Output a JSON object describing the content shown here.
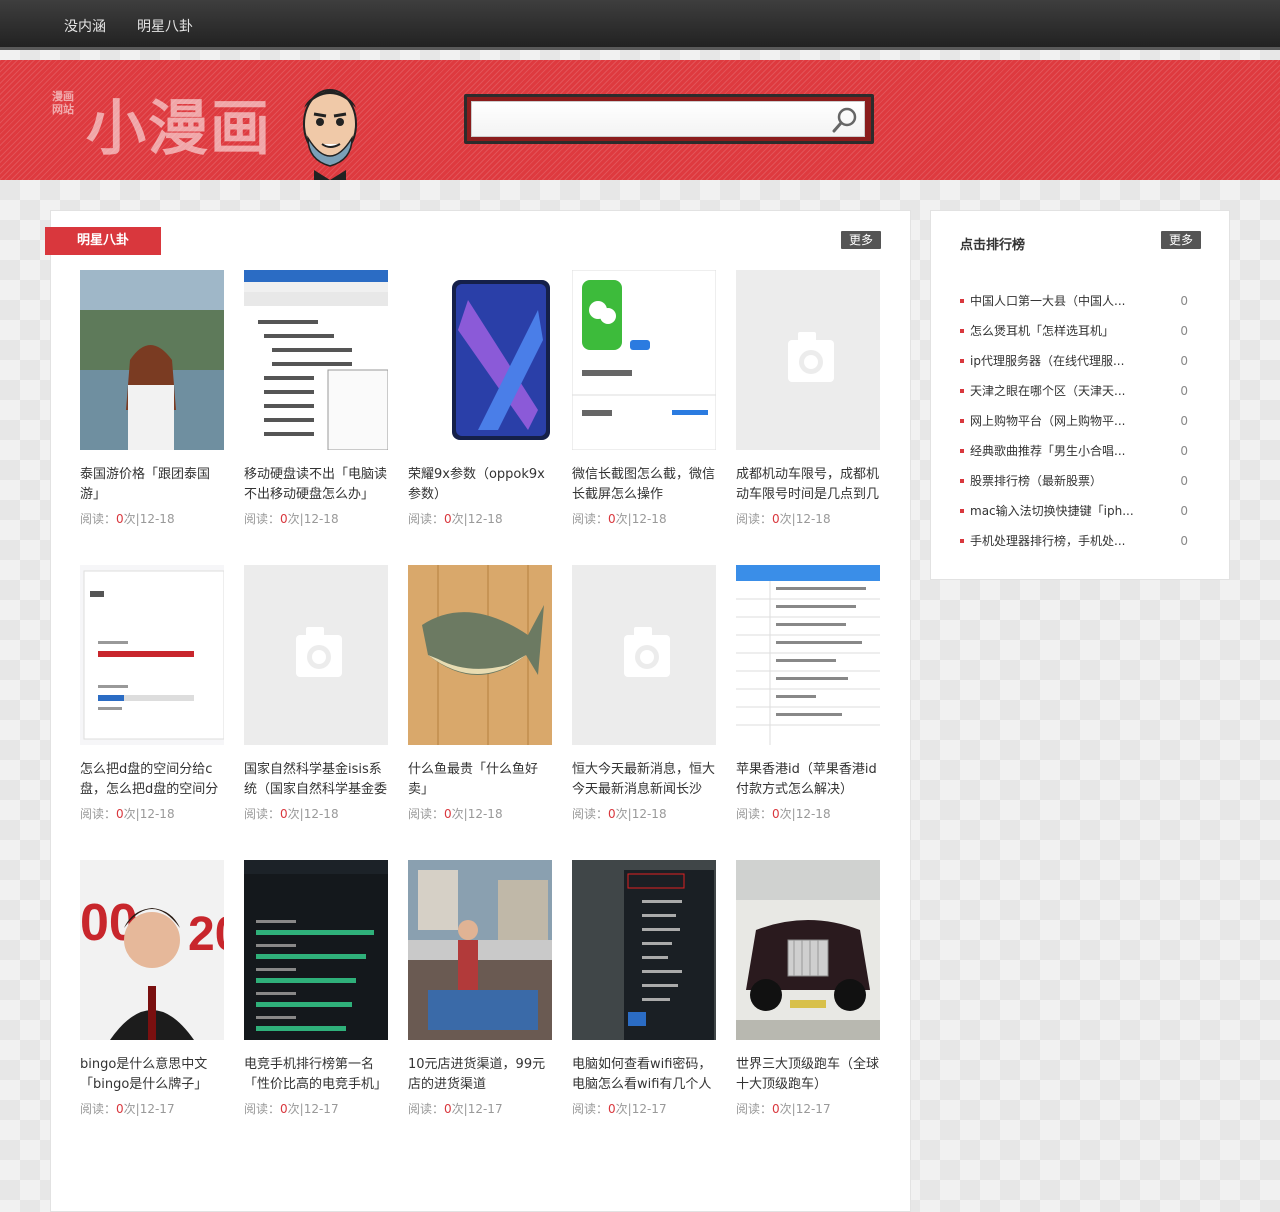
{
  "nav": {
    "items": [
      "没内涵",
      "明星八卦"
    ]
  },
  "brand": {
    "logo_text": "小漫画",
    "logo_small": "漫画网站"
  },
  "search": {
    "value": "",
    "placeholder": ""
  },
  "main": {
    "section_title": "明星八卦",
    "more_label": "更多",
    "meta_prefix": "阅读：",
    "meta_unit": "次|",
    "cards": [
      {
        "title": "泰国游价格「跟团泰国游」",
        "count": "0",
        "date": "12-18",
        "thumb": "photo-woman-beach"
      },
      {
        "title": "移动硬盘读不出「电脑读不出移动硬盘怎么办」",
        "count": "0",
        "date": "12-18",
        "thumb": "screenshot-device-manager"
      },
      {
        "title": "荣耀9x参数（oppok9x参数）",
        "count": "0",
        "date": "12-18",
        "thumb": "photo-phone"
      },
      {
        "title": "微信长截图怎么截，微信长截屏怎么操作",
        "count": "0",
        "date": "12-18",
        "thumb": "screenshot-wechat"
      },
      {
        "title": "成都机动车限号，成都机动车限号时间是几点到几点",
        "count": "0",
        "date": "12-18",
        "thumb": "placeholder-camera"
      },
      {
        "title": "怎么把d盘的空间分给c盘，怎么把d盘的空间分给",
        "count": "0",
        "date": "12-18",
        "thumb": "screenshot-storage"
      },
      {
        "title": "国家自然科学基金isis系统（国家自然科学基金委员会",
        "count": "0",
        "date": "12-18",
        "thumb": "placeholder-camera"
      },
      {
        "title": "什么鱼最贵「什么鱼好卖」",
        "count": "0",
        "date": "12-18",
        "thumb": "photo-fish"
      },
      {
        "title": "恒大今天最新消息，恒大今天最新消息新闻长沙",
        "count": "0",
        "date": "12-18",
        "thumb": "placeholder-camera"
      },
      {
        "title": "苹果香港id（苹果香港id付款方式怎么解决）",
        "count": "0",
        "date": "12-18",
        "thumb": "screenshot-table"
      },
      {
        "title": "bingo是什么意思中文「bingo是什么牌子」",
        "count": "0",
        "date": "12-17",
        "thumb": "photo-man"
      },
      {
        "title": "电竞手机排行榜第一名「性价比高的电竞手机」",
        "count": "0",
        "date": "12-17",
        "thumb": "screenshot-ranking"
      },
      {
        "title": "10元店进货渠道，99元店的进货渠道",
        "count": "0",
        "date": "12-17",
        "thumb": "photo-street"
      },
      {
        "title": "电脑如何查看wifi密码，电脑怎么看wifi有几个人在使",
        "count": "0",
        "date": "12-17",
        "thumb": "screenshot-wifi"
      },
      {
        "title": "世界三大顶级跑车（全球十大顶级跑车）",
        "count": "0",
        "date": "12-17",
        "thumb": "photo-car"
      }
    ]
  },
  "sidebar": {
    "title": "点击排行榜",
    "more_label": "更多",
    "items": [
      {
        "title": "中国人口第一大县（中国人...",
        "count": "0"
      },
      {
        "title": "怎么煲耳机「怎样选耳机」",
        "count": "0"
      },
      {
        "title": "ip代理服务器（在线代理服...",
        "count": "0"
      },
      {
        "title": "天津之眼在哪个区（天津天...",
        "count": "0"
      },
      {
        "title": "网上购物平台（网上购物平...",
        "count": "0"
      },
      {
        "title": "经典歌曲推荐「男生小合唱...",
        "count": "0"
      },
      {
        "title": "股票排行榜（最新股票）",
        "count": "0"
      },
      {
        "title": "mac输入法切换快捷键「iph...",
        "count": "0"
      },
      {
        "title": "手机处理器排行榜，手机处...",
        "count": "0"
      }
    ]
  }
}
